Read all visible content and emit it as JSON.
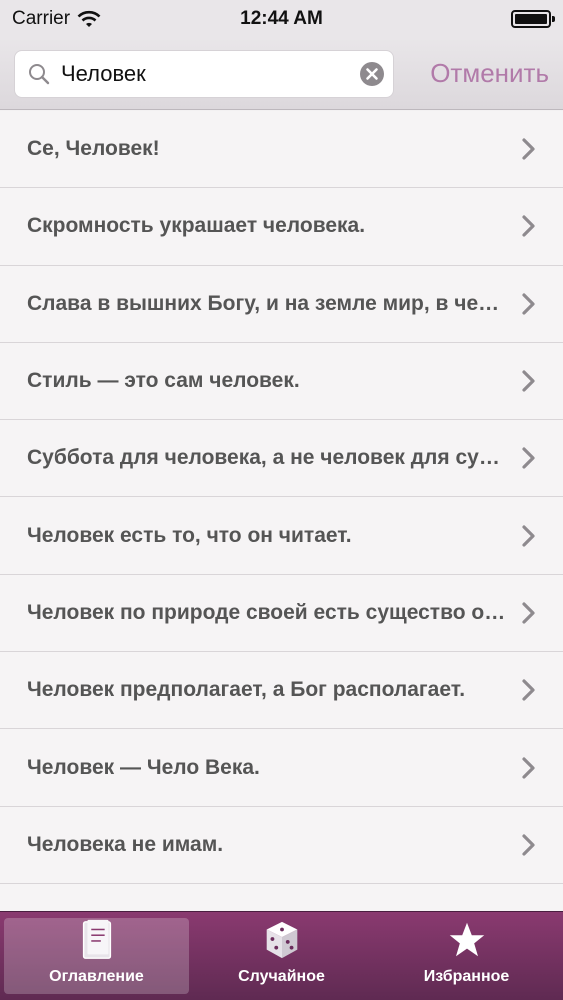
{
  "status_bar": {
    "carrier": "Carrier",
    "time": "12:44 AM"
  },
  "search": {
    "value": "Человек",
    "cancel_label": "Отменить"
  },
  "results": [
    "Се, Человек!",
    "Скромность украшает человека.",
    "Слава в вышних Богу, и на земле мир, в человеках благоволение.",
    "Стиль — это сам человек.",
    "Суббота для человека, а не человек для субботы.",
    "Человек есть то, что он читает.",
    "Человек по природе своей есть существо общественное.",
    "Человек предполагает, а Бог располагает.",
    "Человек — Чело Века.",
    "Человека не имам."
  ],
  "tabs": [
    {
      "label": "Оглавление",
      "icon": "book-icon",
      "active": true
    },
    {
      "label": "Случайное",
      "icon": "dice-icon",
      "active": false
    },
    {
      "label": "Избранное",
      "icon": "star-icon",
      "active": false
    }
  ],
  "colors": {
    "accent": "#b17aa9",
    "tab_bar": "#7a346a"
  }
}
